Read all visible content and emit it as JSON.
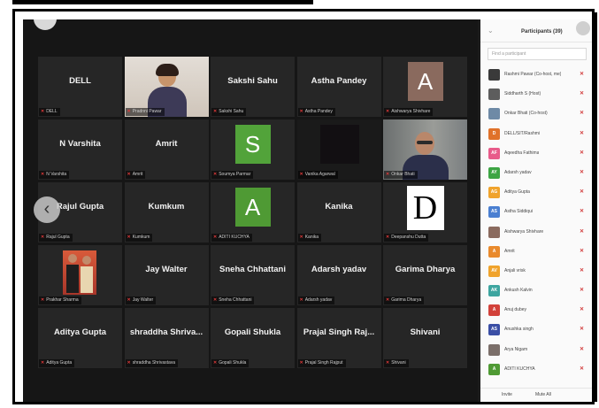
{
  "meeting": {
    "tiles": [
      {
        "name": "DELL",
        "tag": "DELL",
        "kind": "name"
      },
      {
        "name": "",
        "tag": "Pradnni Pawar",
        "kind": "photo-woman"
      },
      {
        "name": "Sakshi Sahu",
        "tag": "Sakshi Sahu",
        "kind": "name"
      },
      {
        "name": "Astha Pandey",
        "tag": "Astha Pandey",
        "kind": "name"
      },
      {
        "name": "",
        "tag": "Aishwarya Shivhare",
        "kind": "letter",
        "letter": "A",
        "color": "#8a6a5e"
      },
      {
        "name": "N Varshita",
        "tag": "N Varshita",
        "kind": "name"
      },
      {
        "name": "Amrit",
        "tag": "Amrit",
        "kind": "name"
      },
      {
        "name": "",
        "tag": "Soumya Parmar",
        "kind": "letter",
        "letter": "S",
        "color": "#52a33a"
      },
      {
        "name": "",
        "tag": "Vanika Agarwal",
        "kind": "dark"
      },
      {
        "name": "",
        "tag": "Onkar Bhati",
        "kind": "photo-man",
        "speaker": true
      },
      {
        "name": "Rajul Gupta",
        "tag": "Rajul Gupta",
        "kind": "name"
      },
      {
        "name": "Kumkum",
        "tag": "Kumkum",
        "kind": "name"
      },
      {
        "name": "",
        "tag": "ADITI KUCHYA",
        "kind": "letter",
        "letter": "A",
        "color": "#4f9a34"
      },
      {
        "name": "Kanika",
        "tag": "Kanika",
        "kind": "name"
      },
      {
        "name": "",
        "tag": "Deepanshu Dutta",
        "kind": "dcard",
        "letter": "D"
      },
      {
        "name": "",
        "tag": "Prakhar Sharma",
        "kind": "photo-couple"
      },
      {
        "name": "Jay Walter",
        "tag": "Jay Walter",
        "kind": "name"
      },
      {
        "name": "Sneha Chhattani",
        "tag": "Sneha Chhattani",
        "kind": "name"
      },
      {
        "name": "Adarsh yadav",
        "tag": "Adarsh yadav",
        "kind": "name"
      },
      {
        "name": "Garima Dharya",
        "tag": "Garima Dharya",
        "kind": "name"
      },
      {
        "name": "Aditya Gupta",
        "tag": "Aditya Gupta",
        "kind": "name"
      },
      {
        "name": "shraddha  Shriva...",
        "tag": "shraddha Shrivastava",
        "kind": "name"
      },
      {
        "name": "Gopali Shukla",
        "tag": "Gopali Shukla",
        "kind": "name"
      },
      {
        "name": "Prajal Singh Raj...",
        "tag": "Prajal Singh Rajput",
        "kind": "name"
      },
      {
        "name": "Shivani",
        "tag": "Shivani",
        "kind": "name"
      }
    ],
    "prev_label": "‹",
    "next_label": "›"
  },
  "panel": {
    "collapse": "⌄",
    "title": "Participants (39)",
    "search_placeholder": "Find a participant",
    "participants": [
      {
        "initials": "",
        "name": "Rashmi Pawar (Co-host, me)",
        "color": "#3a3a3a"
      },
      {
        "initials": "",
        "name": "Siddharth S (Host)",
        "color": "#5d5d5d"
      },
      {
        "initials": "",
        "name": "Onkar Bhati (Co-host)",
        "color": "#6e8aa6"
      },
      {
        "initials": "D",
        "name": "DELL/SIT/Rashmi",
        "color": "#e0722a"
      },
      {
        "initials": "AF",
        "name": "Aqeedha Fathima",
        "color": "#e85b8a"
      },
      {
        "initials": "AY",
        "name": "Adarsh yadav",
        "color": "#3da544"
      },
      {
        "initials": "AG",
        "name": "Aditya Gupta",
        "color": "#f0a32c"
      },
      {
        "initials": "AS",
        "name": "Astha Siddiqui",
        "color": "#4a7fd1"
      },
      {
        "initials": "",
        "name": "Aishwarya Shivhare",
        "color": "#8a6a5e"
      },
      {
        "initials": "A",
        "name": "Amrit",
        "color": "#e98a2c"
      },
      {
        "initials": "AV",
        "name": "Anjali vrisk",
        "color": "#f0a32c"
      },
      {
        "initials": "AK",
        "name": "Ankush Kalvin",
        "color": "#3da5a0"
      },
      {
        "initials": "A",
        "name": "Anuj dubey",
        "color": "#d2413a"
      },
      {
        "initials": "AS",
        "name": "Anushka singh",
        "color": "#3a4ea5"
      },
      {
        "initials": "",
        "name": "Arya Nigam",
        "color": "#7b6f6a"
      },
      {
        "initials": "A",
        "name": "ADITI KUCHYA",
        "color": "#4f9a34"
      }
    ],
    "mic_glyph": "🎙",
    "invite_label": "Invite",
    "mute_all_label": "Mute All"
  }
}
